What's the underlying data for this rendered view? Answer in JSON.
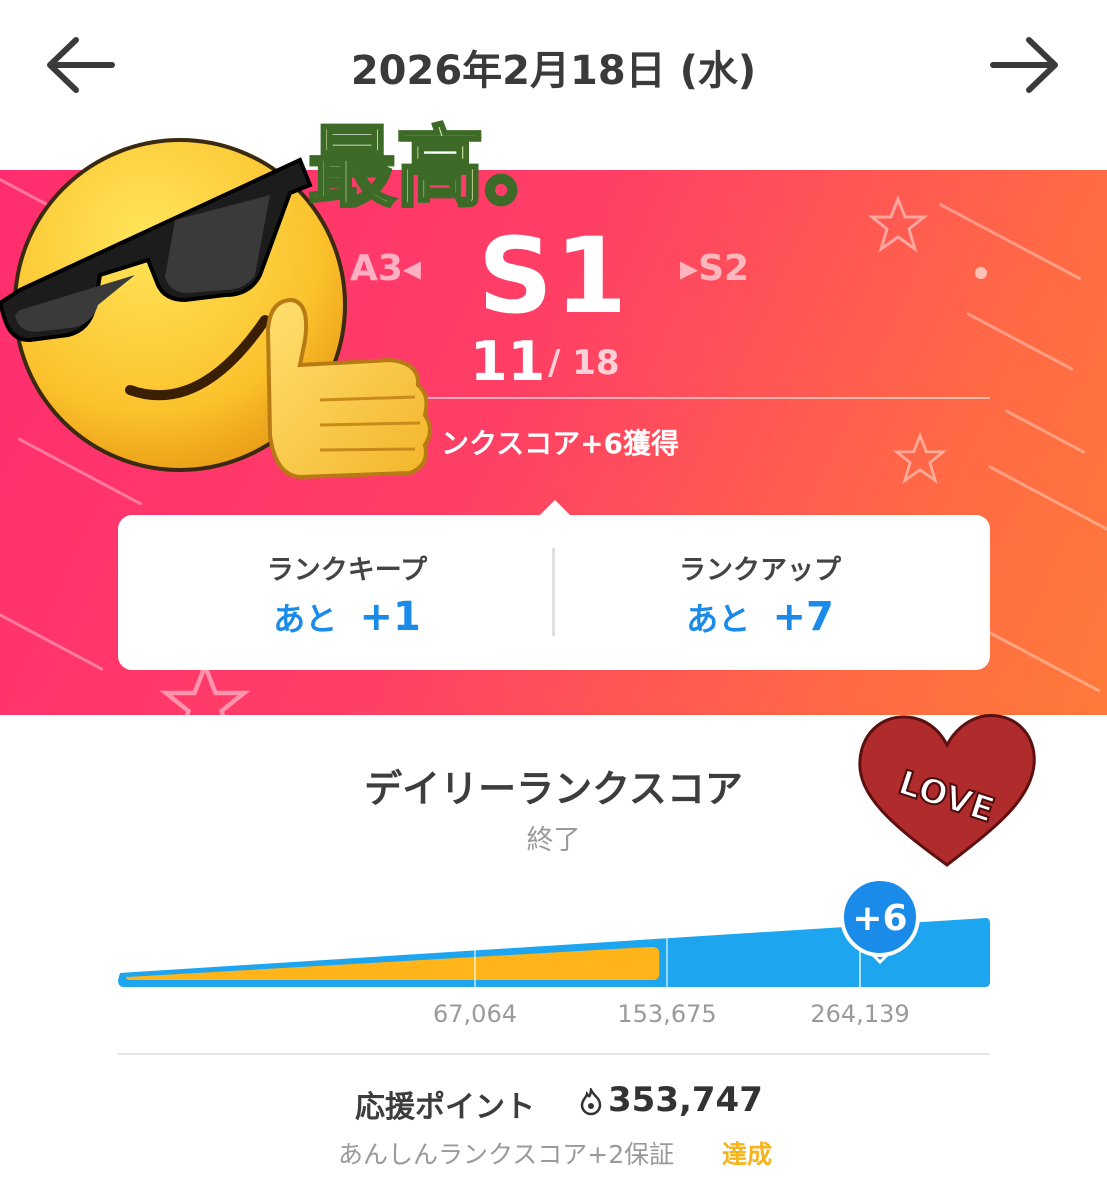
{
  "header": {
    "date": "2026年2月18日 (水)",
    "back_icon": "arrow-left-icon",
    "forward_icon": "arrow-right-icon"
  },
  "rank": {
    "current": "S1",
    "previous": "A3",
    "next": "S2",
    "position": "11",
    "total": "/ 18",
    "earned": "ンクスコア+6獲得"
  },
  "card": {
    "keep_label": "ランクキープ",
    "keep_prefix": "あと",
    "keep_value": "+1",
    "up_label": "ランクアップ",
    "up_prefix": "あと",
    "up_value": "+7"
  },
  "daily": {
    "title": "デイリーランクスコア",
    "status": "終了",
    "badge": "+6",
    "ticks": [
      "67,064",
      "153,675",
      "264,139"
    ],
    "fill_fraction": 0.62
  },
  "points": {
    "label": "応援ポイント",
    "value": "353,747",
    "guarantee": "あんしんランクスコア+2保証",
    "achieved": "達成"
  },
  "stickers": {
    "saiko_text": "最高。",
    "love_text": "LOVE"
  },
  "colors": {
    "banner_start": "#ff2d6f",
    "banner_end": "#ff7a3a",
    "accent_blue": "#1a8be8",
    "bar_orange": "#ffb51a",
    "achieved_yellow": "#f5b31c"
  }
}
